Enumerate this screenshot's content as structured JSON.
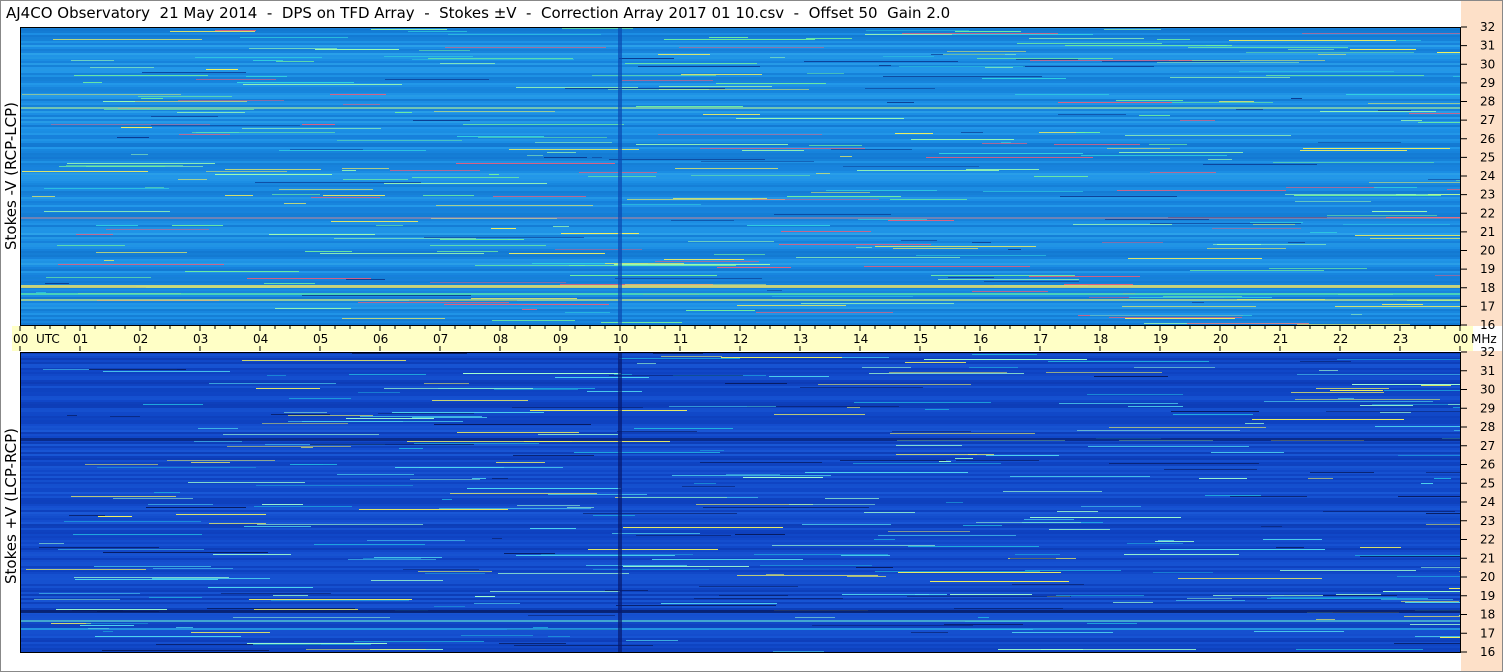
{
  "title": "AJ4CO Observatory  21 May 2014  -  DPS on TFD Array  -  Stokes ±V  -  Correction Array 2017 01 10.csv  -  Offset 50  Gain 2.0",
  "colors": {
    "top_base": "#1a8ce0",
    "bottom_base": "#1148c8",
    "axis_yellow": "#ffffc6",
    "axis_peach": "#fde0c8"
  },
  "chart_data": [
    {
      "type": "heatmap",
      "panel": "top",
      "ylabel": "Stokes -V (RCP-LCP)",
      "x_unit": "UTC",
      "x_ticks": [
        "00",
        "01",
        "02",
        "03",
        "04",
        "05",
        "06",
        "07",
        "08",
        "09",
        "10",
        "11",
        "12",
        "13",
        "14",
        "15",
        "16",
        "17",
        "18",
        "19",
        "20",
        "21",
        "22",
        "23",
        "00"
      ],
      "y_unit": "MHz",
      "y_ticks": [
        "16",
        "17",
        "18",
        "19",
        "20",
        "21",
        "22",
        "23",
        "24",
        "25",
        "26",
        "27",
        "28",
        "29",
        "30",
        "31",
        "32"
      ],
      "xlim": [
        0,
        24
      ],
      "ylim": [
        16,
        32
      ]
    },
    {
      "type": "heatmap",
      "panel": "bottom",
      "ylabel": "Stokes +V (LCP-RCP)",
      "x_unit": "UTC",
      "x_ticks": [
        "00",
        "01",
        "02",
        "03",
        "04",
        "05",
        "06",
        "07",
        "08",
        "09",
        "10",
        "11",
        "12",
        "13",
        "14",
        "15",
        "16",
        "17",
        "18",
        "19",
        "20",
        "21",
        "22",
        "23",
        "00"
      ],
      "y_unit": "MHz",
      "y_ticks": [
        "16",
        "17",
        "18",
        "19",
        "20",
        "21",
        "22",
        "23",
        "24",
        "25",
        "26",
        "27",
        "28",
        "29",
        "30",
        "31",
        "32"
      ],
      "xlim": [
        0,
        24
      ],
      "ylim": [
        16,
        32
      ]
    }
  ]
}
